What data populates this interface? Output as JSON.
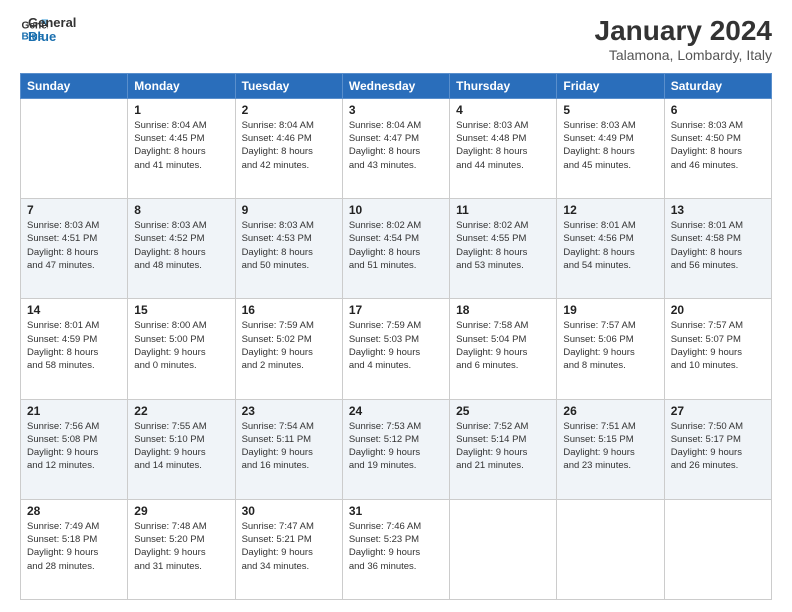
{
  "logo": {
    "line1": "General",
    "line2": "Blue"
  },
  "title": "January 2024",
  "subtitle": "Talamona, Lombardy, Italy",
  "headers": [
    "Sunday",
    "Monday",
    "Tuesday",
    "Wednesday",
    "Thursday",
    "Friday",
    "Saturday"
  ],
  "rows": [
    {
      "alt": false,
      "cells": [
        {
          "day": "",
          "info": ""
        },
        {
          "day": "1",
          "info": "Sunrise: 8:04 AM\nSunset: 4:45 PM\nDaylight: 8 hours\nand 41 minutes."
        },
        {
          "day": "2",
          "info": "Sunrise: 8:04 AM\nSunset: 4:46 PM\nDaylight: 8 hours\nand 42 minutes."
        },
        {
          "day": "3",
          "info": "Sunrise: 8:04 AM\nSunset: 4:47 PM\nDaylight: 8 hours\nand 43 minutes."
        },
        {
          "day": "4",
          "info": "Sunrise: 8:03 AM\nSunset: 4:48 PM\nDaylight: 8 hours\nand 44 minutes."
        },
        {
          "day": "5",
          "info": "Sunrise: 8:03 AM\nSunset: 4:49 PM\nDaylight: 8 hours\nand 45 minutes."
        },
        {
          "day": "6",
          "info": "Sunrise: 8:03 AM\nSunset: 4:50 PM\nDaylight: 8 hours\nand 46 minutes."
        }
      ]
    },
    {
      "alt": true,
      "cells": [
        {
          "day": "7",
          "info": "Sunrise: 8:03 AM\nSunset: 4:51 PM\nDaylight: 8 hours\nand 47 minutes."
        },
        {
          "day": "8",
          "info": "Sunrise: 8:03 AM\nSunset: 4:52 PM\nDaylight: 8 hours\nand 48 minutes."
        },
        {
          "day": "9",
          "info": "Sunrise: 8:03 AM\nSunset: 4:53 PM\nDaylight: 8 hours\nand 50 minutes."
        },
        {
          "day": "10",
          "info": "Sunrise: 8:02 AM\nSunset: 4:54 PM\nDaylight: 8 hours\nand 51 minutes."
        },
        {
          "day": "11",
          "info": "Sunrise: 8:02 AM\nSunset: 4:55 PM\nDaylight: 8 hours\nand 53 minutes."
        },
        {
          "day": "12",
          "info": "Sunrise: 8:01 AM\nSunset: 4:56 PM\nDaylight: 8 hours\nand 54 minutes."
        },
        {
          "day": "13",
          "info": "Sunrise: 8:01 AM\nSunset: 4:58 PM\nDaylight: 8 hours\nand 56 minutes."
        }
      ]
    },
    {
      "alt": false,
      "cells": [
        {
          "day": "14",
          "info": "Sunrise: 8:01 AM\nSunset: 4:59 PM\nDaylight: 8 hours\nand 58 minutes."
        },
        {
          "day": "15",
          "info": "Sunrise: 8:00 AM\nSunset: 5:00 PM\nDaylight: 9 hours\nand 0 minutes."
        },
        {
          "day": "16",
          "info": "Sunrise: 7:59 AM\nSunset: 5:02 PM\nDaylight: 9 hours\nand 2 minutes."
        },
        {
          "day": "17",
          "info": "Sunrise: 7:59 AM\nSunset: 5:03 PM\nDaylight: 9 hours\nand 4 minutes."
        },
        {
          "day": "18",
          "info": "Sunrise: 7:58 AM\nSunset: 5:04 PM\nDaylight: 9 hours\nand 6 minutes."
        },
        {
          "day": "19",
          "info": "Sunrise: 7:57 AM\nSunset: 5:06 PM\nDaylight: 9 hours\nand 8 minutes."
        },
        {
          "day": "20",
          "info": "Sunrise: 7:57 AM\nSunset: 5:07 PM\nDaylight: 9 hours\nand 10 minutes."
        }
      ]
    },
    {
      "alt": true,
      "cells": [
        {
          "day": "21",
          "info": "Sunrise: 7:56 AM\nSunset: 5:08 PM\nDaylight: 9 hours\nand 12 minutes."
        },
        {
          "day": "22",
          "info": "Sunrise: 7:55 AM\nSunset: 5:10 PM\nDaylight: 9 hours\nand 14 minutes."
        },
        {
          "day": "23",
          "info": "Sunrise: 7:54 AM\nSunset: 5:11 PM\nDaylight: 9 hours\nand 16 minutes."
        },
        {
          "day": "24",
          "info": "Sunrise: 7:53 AM\nSunset: 5:12 PM\nDaylight: 9 hours\nand 19 minutes."
        },
        {
          "day": "25",
          "info": "Sunrise: 7:52 AM\nSunset: 5:14 PM\nDaylight: 9 hours\nand 21 minutes."
        },
        {
          "day": "26",
          "info": "Sunrise: 7:51 AM\nSunset: 5:15 PM\nDaylight: 9 hours\nand 23 minutes."
        },
        {
          "day": "27",
          "info": "Sunrise: 7:50 AM\nSunset: 5:17 PM\nDaylight: 9 hours\nand 26 minutes."
        }
      ]
    },
    {
      "alt": false,
      "cells": [
        {
          "day": "28",
          "info": "Sunrise: 7:49 AM\nSunset: 5:18 PM\nDaylight: 9 hours\nand 28 minutes."
        },
        {
          "day": "29",
          "info": "Sunrise: 7:48 AM\nSunset: 5:20 PM\nDaylight: 9 hours\nand 31 minutes."
        },
        {
          "day": "30",
          "info": "Sunrise: 7:47 AM\nSunset: 5:21 PM\nDaylight: 9 hours\nand 34 minutes."
        },
        {
          "day": "31",
          "info": "Sunrise: 7:46 AM\nSunset: 5:23 PM\nDaylight: 9 hours\nand 36 minutes."
        },
        {
          "day": "",
          "info": ""
        },
        {
          "day": "",
          "info": ""
        },
        {
          "day": "",
          "info": ""
        }
      ]
    }
  ]
}
